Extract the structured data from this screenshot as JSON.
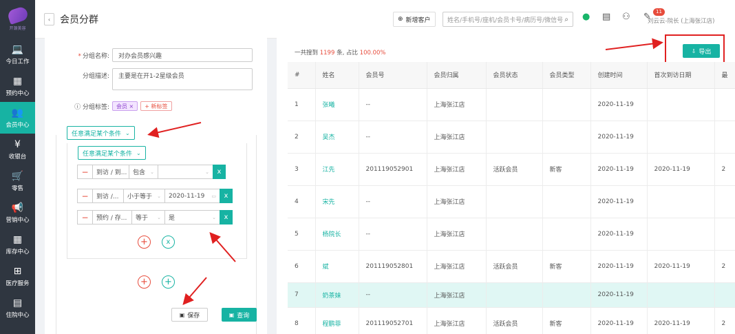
{
  "sidebar": {
    "logo_text": "开源美容",
    "items": [
      {
        "label": "今日工作",
        "icon": "laptop-icon",
        "glyph": "💻"
      },
      {
        "label": "预约中心",
        "icon": "calendar-icon",
        "glyph": "▦"
      },
      {
        "label": "会员中心",
        "icon": "members-icon",
        "glyph": "👥"
      },
      {
        "label": "收银台",
        "icon": "yen-icon",
        "glyph": "¥"
      },
      {
        "label": "零售",
        "icon": "cart-icon",
        "glyph": "🛒"
      },
      {
        "label": "营销中心",
        "icon": "megaphone-icon",
        "glyph": "📢"
      },
      {
        "label": "库存中心",
        "icon": "grid-icon",
        "glyph": "▦"
      },
      {
        "label": "医疗服务",
        "icon": "medkit-icon",
        "glyph": "⊞"
      },
      {
        "label": "住院中心",
        "icon": "building-icon",
        "glyph": "▤"
      }
    ],
    "active_index": 2,
    "active_color": "#17b3a3"
  },
  "header": {
    "back": "‹",
    "title": "会员分群",
    "new_customer": "新增客户",
    "search_placeholder": "姓名/手机号/座机/会员卡号/病历号/微信号",
    "notification_count": "11",
    "user": "刘云云-院长 (上海张江店)"
  },
  "form": {
    "name_label": "分组名称:",
    "name_value": "对办会员感兴趣",
    "desc_label": "分组描述:",
    "desc_value": "主要是在开1-2星级会员",
    "tags_label": "分组标签:",
    "tags": [
      {
        "text": "会员",
        "close": "×"
      }
    ],
    "add_tag": "+ 新标签",
    "outer_condition": "任意满足某个条件",
    "inner_condition": "任意满足某个条件",
    "conditions": [
      {
        "field": "到访 / 到...",
        "op": "包含",
        "value": ""
      },
      {
        "field": "到访 /...",
        "op": "小于等于",
        "value": "2020-11-19"
      },
      {
        "field": "预约 / 存...",
        "op": "等于",
        "value": "是"
      }
    ],
    "minus": "−",
    "remove": "x",
    "plus_circle": "+",
    "x_circle": "x",
    "save_label": "保存",
    "query_label": "查询"
  },
  "results": {
    "summary_prefix": "一共搜到",
    "count": "1199",
    "summary_mid": "条, 占比",
    "percent": "100.00%",
    "export_label": "导出",
    "columns": [
      "#",
      "姓名",
      "会员号",
      "会员归属",
      "会员状态",
      "会员类型",
      "创建时间",
      "首次到访日期",
      "最"
    ],
    "rows": [
      [
        "1",
        "张曦",
        "--",
        "上海张江店",
        "",
        "",
        "2020-11-19",
        "",
        ""
      ],
      [
        "2",
        "吴杰",
        "--",
        "上海张江店",
        "",
        "",
        "2020-11-19",
        "",
        ""
      ],
      [
        "3",
        "江先",
        "201119052901",
        "上海张江店",
        "活跃会员",
        "新客",
        "2020-11-19",
        "2020-11-19",
        "2"
      ],
      [
        "4",
        "宋先",
        "--",
        "上海张江店",
        "",
        "",
        "2020-11-19",
        "",
        ""
      ],
      [
        "5",
        "杨院长",
        "--",
        "上海张江店",
        "",
        "",
        "2020-11-19",
        "",
        ""
      ],
      [
        "6",
        "斌",
        "201119052801",
        "上海张江店",
        "活跃会员",
        "新客",
        "2020-11-19",
        "2020-11-19",
        "2"
      ],
      [
        "7",
        "奶茶妹",
        "--",
        "上海张江店",
        "",
        "",
        "2020-11-19",
        "",
        ""
      ],
      [
        "8",
        "程鹏菲",
        "201119052701",
        "上海张江店",
        "活跃会员",
        "新客",
        "2020-11-19",
        "2020-11-19",
        "2"
      ]
    ],
    "highlight_row": 6
  },
  "colors": {
    "accent": "#17b3a3",
    "annotation": "#e02020",
    "sidebar_bg": "#2f3640"
  }
}
